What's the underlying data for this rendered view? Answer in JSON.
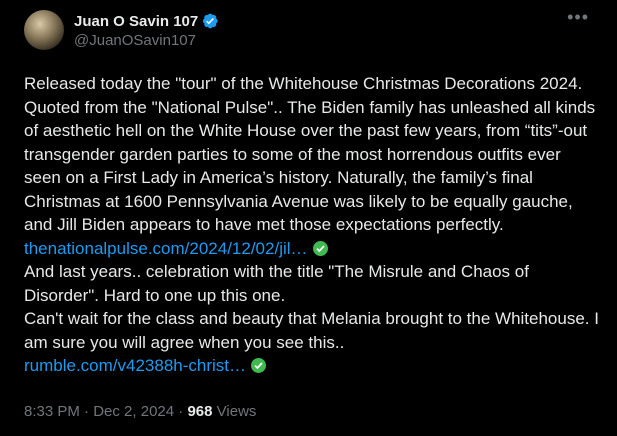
{
  "author": {
    "display_name": "Juan O Savin 107",
    "handle": "@JuanOSavin107"
  },
  "more_icon": "ellipsis-icon",
  "text": {
    "p1": "Released today the \"tour\" of the Whitehouse Christmas Decorations 2024. Quoted from the \"National Pulse\".. The Biden family has unleashed all kinds of aesthetic hell on the White House over the past few years, from “tits”-out transgender garden parties to some of the most horrendous outfits ever seen on a First Lady in America’s history. Naturally,  the family’s final Christmas at 1600 Pennsylvania Avenue was likely to  be equally gauche, and Jill Biden appears to have met those expectations  perfectly. ",
    "link1": "thenationalpulse.com/2024/12/02/jil…",
    "p2": "And last years.. celebration with the title \"The Misrule and Chaos of Disorder\". Hard to one up this one.",
    "p3": "Can't wait for the class and beauty that Melania brought to the Whitehouse. I am sure  you will agree when you see this..",
    "link2": "rumble.com/v42388h-christ…"
  },
  "meta": {
    "time": "8:33 PM",
    "sep": " · ",
    "date": "Dec 2, 2024",
    "views_count": "968",
    "views_label": "Views"
  },
  "colors": {
    "background": "#000000",
    "text": "#e7e9ea",
    "secondary": "#71767b",
    "link": "#1d9bf0",
    "verified": "#1d9bf0",
    "link_check": "#3fb950"
  }
}
